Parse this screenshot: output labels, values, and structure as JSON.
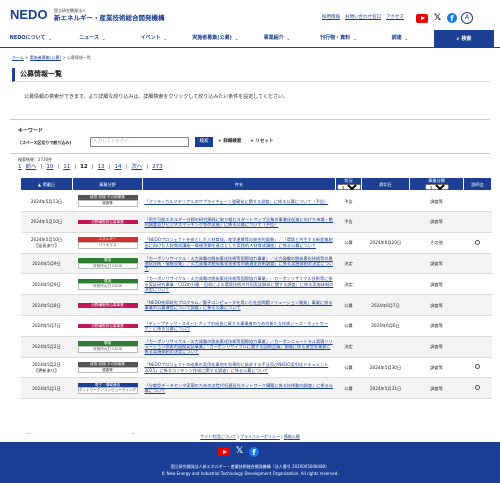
{
  "header": {
    "logo_text": "NEDO",
    "org_sub": "国立研究開発法人",
    "org_name": "新エネルギー・産業技術総合開発機構",
    "links": [
      "採用情報",
      "お問い合わせ窓口",
      "アクセス"
    ],
    "lang_label": "A"
  },
  "nav": {
    "items": [
      "NEDOについて",
      "ニュース",
      "イベント",
      "実施者募集(公募)",
      "事業紹介",
      "刊行物・資料",
      "調達"
    ],
    "search_label": "検索"
  },
  "breadcrumb": [
    "ホーム",
    "実施者募集(公募)",
    "公募情報一覧"
  ],
  "page_title": "公募情報一覧",
  "description": "公募情報の検索ができます。より詳細な絞り込みは、詳細検索をクリックして絞り込みたい条件を設定してください。",
  "keyword": {
    "label": "キーワード",
    "sub_label": "(スペース区切りで絞り込み)",
    "placeholder": "入力してください",
    "search_button": "検索",
    "detail_label": "+ 詳細検索",
    "reset_label": "× リセット"
  },
  "result_count": "検索結果：2730件",
  "pager": {
    "first": "1",
    "prev": "前へ",
    "pages": [
      "10",
      "11",
      "12",
      "13",
      "14"
    ],
    "current": "12",
    "next": "次へ",
    "last": "273"
  },
  "table": {
    "headers": {
      "date": "掲載日",
      "dept": "事業分野",
      "subject": "件名",
      "status": "状況",
      "status_select": "すべて",
      "deadline": "締切日",
      "category": "事業分類",
      "category_select": "すべて",
      "briefing": "説明会"
    },
    "rows": [
      {
        "date": "2024年5月13日",
        "dept": "経営 評価 その他事業",
        "dept_sub": "調査等",
        "dept_color": "#555555",
        "subject": "「クリティカルマテリアルのサプライチェーン強靭化に関する調査」に係る公募について（予告）",
        "status": "予告",
        "deadline": "",
        "category": "調査等",
        "briefing": ""
      },
      {
        "date": "2024年5月10日",
        "dept": "分野横断的公募事業",
        "dept_sub": "",
        "dept_color": "#c2185b",
        "subject": "「再生可能エネルギー分野の研究開発に取り組むスタートアップ企業の事業化促進に向けた市場・動向調査及びビジネスマッチング等の実施」に係る公募について（予告）",
        "status": "予告",
        "deadline": "",
        "category": "調査等",
        "briefing": ""
      },
      {
        "date": "2024年5月10日",
        "date_note": "【延長あり】",
        "dept": "エネルギー",
        "dept_sub": "バイオマス",
        "dept_color": "#d32f2f",
        "subject": "「NEDOプロジェクトを核とした人材育成、産学連携等の総合的展開」／「環境と共生する新産業創出に向けた人材育成講座―微細藻類を基点とした実践的人材育成講座」に係る公募について",
        "status": "公募",
        "deadline": "2024年6月20日",
        "category": "その他",
        "briefing": "circle"
      },
      {
        "date": "2024年5月9日",
        "dept": "環境",
        "dept_sub": "次世代火力 CCUS",
        "dept_color": "#2e7d32",
        "subject": "「カーボンリサイクル・火力発電の脱炭素化技術等国際協力事業」／火力発電の脱炭素化技術等の最適化技術・情報収集」／火力発電の脱炭素化技術等の最適化技術調査」に係る実施体制の決定について",
        "status": "決定",
        "deadline": "",
        "category": "調査等",
        "briefing": ""
      },
      {
        "date": "2024年5月9日",
        "dept": "環境",
        "dept_sub": "次世代火力 CCUS",
        "dept_color": "#2e7d32",
        "subject": "「カーボンリサイクル・火力発電の脱炭素化技術等国際協力事業」／カーボンリサイクル技術等に係る実証研究事業／CO2の分離・回収による環境技術の共同実証開発に関する調査」に係る実施体制の決定について",
        "status": "決定",
        "deadline": "",
        "category": "調査等",
        "briefing": ""
      },
      {
        "date": "2024年5月8日",
        "dept": "分野横断的公募事業",
        "dept_sub": "",
        "dept_color": "#c2185b",
        "subject": "「NEDO先導研究プログラム／量子コンピュータを用いた社会問題ソリューション開発」事業に係る事業の公募運営について調査」に係る公募について",
        "status": "公募",
        "deadline": "2024年6月7日",
        "category": "調査等",
        "briefing": ""
      },
      {
        "date": "2024年5月7日",
        "dept": "分野横断的公募事業",
        "dept_sub": "",
        "dept_color": "#c2185b",
        "subject": "「ディープテック・スタートアップの成長に資する事業者のための新たな技術シーズ・ネットワーク」に係る公募について",
        "status": "公募",
        "deadline": "2024年6月6日",
        "category": "調査等",
        "briefing": ""
      },
      {
        "date": "2024年5月2日",
        "dept": "環境",
        "dept_sub": "次世代火力 CCUS",
        "dept_color": "#2e7d32",
        "subject": "「カーボンリサイクル・火力発電の脱炭素化技術等国際協力事業」／カーボンニュートラル実現ソリューション技術の国際実証事業」「カーボンリサイクルに関する国際会議」開催に係る運営等業務に係る実施体制の決定について",
        "status": "決定",
        "deadline": "",
        "category": "調査等",
        "briefing": ""
      },
      {
        "date": "2024年5月2日",
        "date_note": "【更新あり】",
        "dept": "経営 評価 その他事業",
        "dept_sub": "調査等",
        "dept_color": "#555555",
        "subject": "「NEDOプロジェクトの成果の実用化事例を効果的に訴求する手法及びNEDO実用化ドキュメント2025」に係るコンテンツ作成に関する調査」に係る公募について",
        "status": "公募",
        "deadline": "2024年5月30日",
        "category": "調査等",
        "briefing": "circle"
      },
      {
        "date": "2024年5月1日",
        "dept": "電子・情報通信",
        "dept_sub": "ネットワーク／コンピューティング",
        "dept_color": "#1a3f95",
        "subject": "「分散型データセンタ実現のための次世代低遅延光ネットワーク構築に係る技術動向調査」に係る公募について",
        "status": "公募",
        "deadline": "2024年5月31日",
        "category": "調査等",
        "briefing": "circle"
      }
    ]
  },
  "footer": {
    "links": [
      "サイト利用について",
      "プライバシーポリシー",
      "情報公開"
    ],
    "org_line": "国立研究開発法人新エネルギー・産業技術総合開発機構（法人番号 2020005008480）",
    "copyright": "© New Energy and Industrial Technology Development Organization. All rights reserved."
  }
}
